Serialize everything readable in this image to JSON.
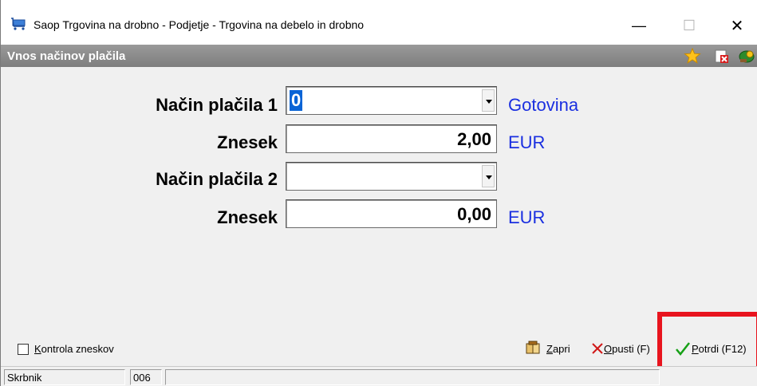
{
  "window": {
    "title": "Saop Trgovina na drobno - Podjetje - Trgovina na debelo in drobno",
    "minimize": "—",
    "maximize": "☐",
    "close": "✕"
  },
  "header": {
    "title": "Vnos načinov plačila"
  },
  "form": {
    "payment1": {
      "label": "Način plačila 1",
      "value": "0",
      "description": "Gotovina"
    },
    "amount1": {
      "label": "Znesek",
      "value": "2,00",
      "currency": "EUR"
    },
    "payment2": {
      "label": "Način plačila 2",
      "value": "",
      "description": ""
    },
    "amount2": {
      "label": "Znesek",
      "value": "0,00",
      "currency": "EUR"
    }
  },
  "actions": {
    "checkbox_label_prefix": "K",
    "checkbox_label_rest": "ontrola zneskov",
    "zapri_prefix": "Z",
    "zapri_rest": "apri",
    "opusti_prefix": "O",
    "opusti_rest": "pusti (F",
    "opusti_tail": ")",
    "potrdi_prefix": "P",
    "potrdi_rest": "otrdi (F12)"
  },
  "status": {
    "user": "Skrbnik",
    "code": "006"
  },
  "colors": {
    "accent_blue": "#1a2fe0",
    "highlight_red": "#e8141e",
    "selection": "#0a64d6"
  },
  "icons": [
    "cart-icon",
    "star-icon",
    "exit-icon",
    "help-icon",
    "book-icon",
    "cancel-x-icon",
    "check-icon"
  ]
}
